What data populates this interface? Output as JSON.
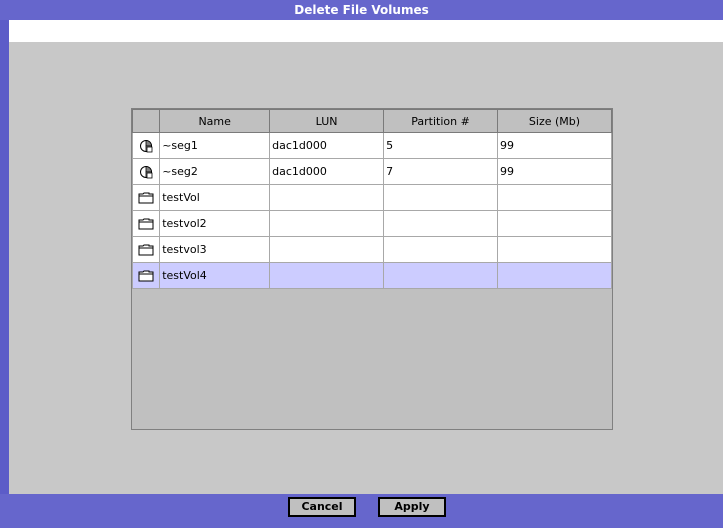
{
  "window": {
    "title": "Delete File Volumes"
  },
  "table": {
    "columns": [
      "",
      "Name",
      "LUN",
      "Partition #",
      "Size (Mb)"
    ],
    "rows": [
      {
        "icon": "segment-icon",
        "name": "~seg1",
        "lun": "dac1d000",
        "partition": "5",
        "size": "99",
        "selected": false
      },
      {
        "icon": "segment-icon",
        "name": "~seg2",
        "lun": "dac1d000",
        "partition": "7",
        "size": "99",
        "selected": false
      },
      {
        "icon": "folder-icon",
        "name": "testVol",
        "lun": "",
        "partition": "",
        "size": "",
        "selected": false
      },
      {
        "icon": "folder-icon",
        "name": "testvol2",
        "lun": "",
        "partition": "",
        "size": "",
        "selected": false
      },
      {
        "icon": "folder-icon",
        "name": "testvol3",
        "lun": "",
        "partition": "",
        "size": "",
        "selected": false
      },
      {
        "icon": "folder-icon",
        "name": "testVol4",
        "lun": "",
        "partition": "",
        "size": "",
        "selected": true
      }
    ]
  },
  "buttons": {
    "cancel": "Cancel",
    "apply": "Apply"
  },
  "colors": {
    "titlebar": "#6666cc",
    "selected_row": "#ccccff",
    "background": "#c8c8c8"
  }
}
